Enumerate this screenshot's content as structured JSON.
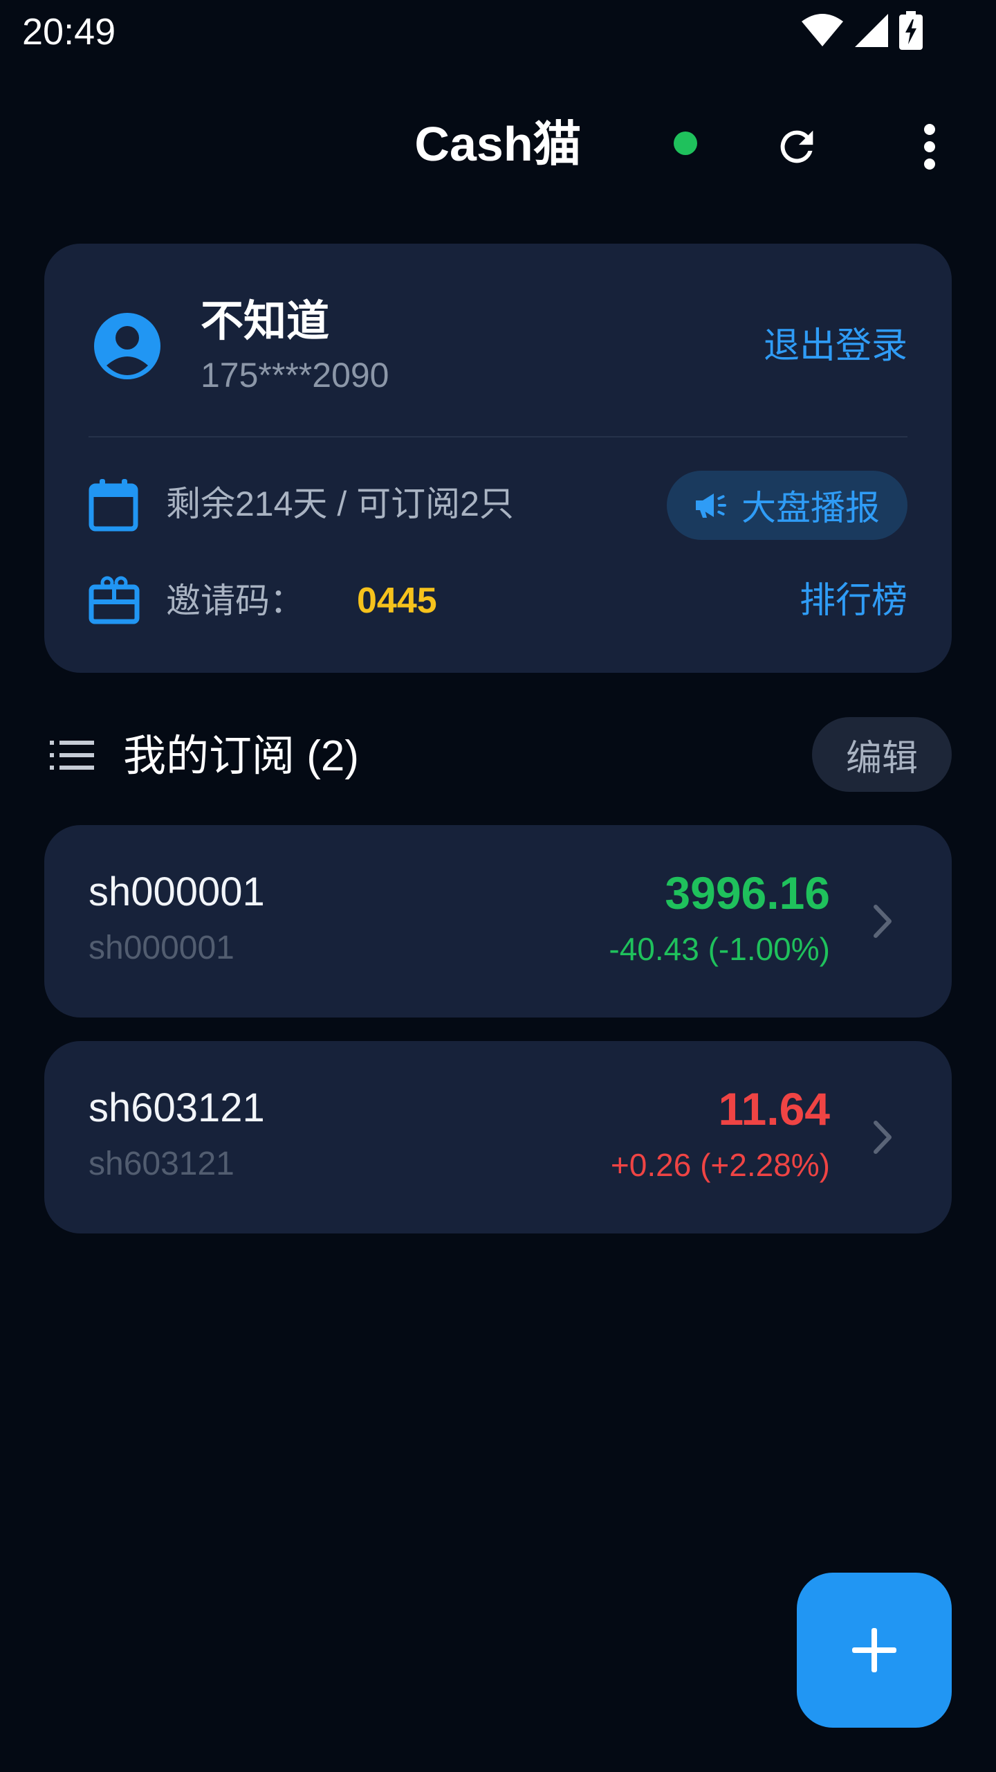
{
  "status_bar": {
    "time": "20:49",
    "icons": [
      "wifi-icon",
      "signal-icon",
      "battery-charging-icon"
    ]
  },
  "app_bar": {
    "title": "Cash猫",
    "status_color": "#1fc15c",
    "icons": [
      "refresh-icon",
      "more-vert-icon"
    ]
  },
  "profile": {
    "name": "不知道",
    "phone": "175****2090",
    "logout_label": "退出登录",
    "remaining": "剩余214天 / 可订阅2只",
    "broadcast_label": "大盘播报",
    "invite_label": "邀请码：",
    "invite_code": "0445",
    "ranking_label": "排行榜"
  },
  "subscriptions": {
    "title": "我的订阅 (2)",
    "edit_label": "编辑",
    "items": [
      {
        "code": "sh000001",
        "sub": "sh000001",
        "price": "3996.16",
        "change": "-40.43 (-1.00%)",
        "trend": "down"
      },
      {
        "code": "sh603121",
        "sub": "sh603121",
        "price": "11.64",
        "change": "+0.26 (+2.28%)",
        "trend": "up"
      }
    ]
  },
  "fab": {
    "icon": "add-icon"
  },
  "colors": {
    "accent": "#2196f3",
    "link": "#2f9cf6",
    "down": "#1fc15c",
    "up": "#ef4444",
    "invite_code": "#f6c21c",
    "card": "#17223a",
    "background": "#040a14"
  }
}
